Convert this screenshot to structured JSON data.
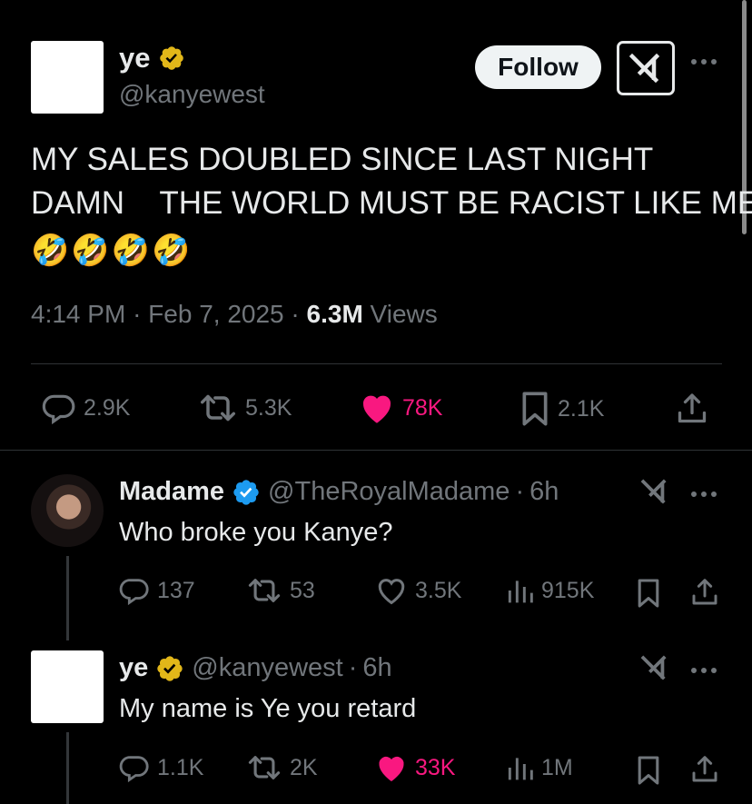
{
  "main_tweet": {
    "display_name": "ye",
    "handle": "@kanyewest",
    "follow_label": "Follow",
    "text_line1": "MY SALES DOUBLED SINCE LAST NIGHT",
    "text_line2": "DAMN    THE WORLD MUST BE RACIST LIKE ME",
    "emojis": [
      "🤣",
      "🤣",
      "🤣",
      "🤣"
    ],
    "time": "4:14 PM",
    "date": "Feb 7, 2025",
    "views_count": "6.3M",
    "views_label": "Views",
    "replies": "2.9K",
    "reposts": "5.3K",
    "likes": "78K",
    "bookmarks": "2.1K"
  },
  "replies": [
    {
      "display_name": "Madame",
      "handle": "@TheRoyalMadame",
      "separator": "·",
      "time": "6h",
      "text": "Who broke you Kanye?",
      "replies": "137",
      "reposts": "53",
      "likes": "3.5K",
      "views": "915K",
      "liked": false,
      "verified": "blue"
    },
    {
      "display_name": "ye",
      "handle": "@kanyewest",
      "separator": "·",
      "time": "6h",
      "text": "My name is Ye you retard",
      "replies": "1.1K",
      "reposts": "2K",
      "likes": "33K",
      "views": "1M",
      "liked": true,
      "verified": "gold"
    }
  ],
  "colors": {
    "background": "#000000",
    "text": "#e7e9ea",
    "muted": "#71767b",
    "like_pink": "#f91880",
    "verified_gold": "#e2b719",
    "verified_blue": "#1d9bf0"
  }
}
